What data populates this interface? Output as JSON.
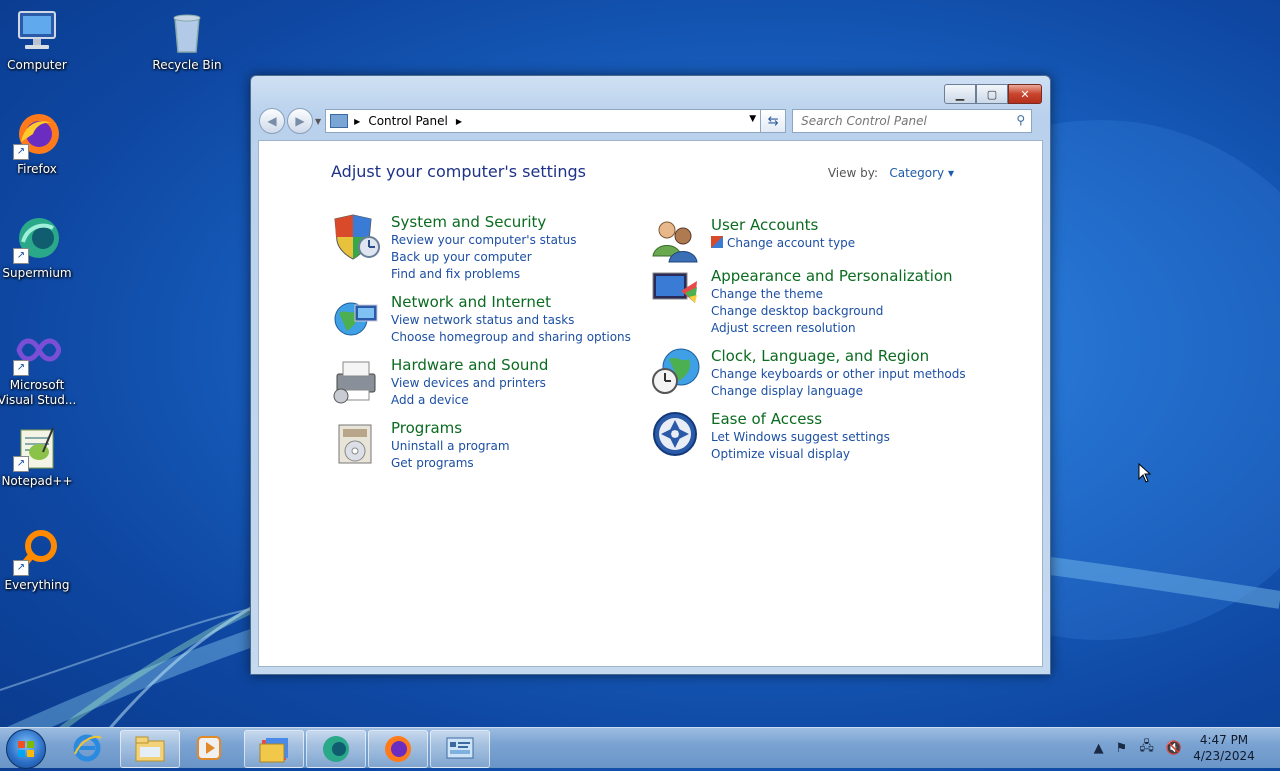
{
  "desktop": {
    "icons": [
      {
        "label": "Computer"
      },
      {
        "label": "Recycle Bin"
      },
      {
        "label": "Firefox"
      },
      {
        "label": "Supermium"
      },
      {
        "label": "Microsoft Visual Stud..."
      },
      {
        "label": "Notepad++"
      },
      {
        "label": "Everything"
      }
    ]
  },
  "window": {
    "controls": {
      "minimize": "▁",
      "maximize": "▢",
      "close": "✕"
    },
    "address": {
      "crumb": "Control Panel"
    },
    "search": {
      "placeholder": "Search Control Panel"
    },
    "content_title": "Adjust your computer's settings",
    "view_by_label": "View by:",
    "view_by_value": "Category ▾",
    "categories_left": [
      {
        "title": "System and Security",
        "icon": "shield-icon",
        "links": [
          "Review your computer's status",
          "Back up your computer",
          "Find and fix problems"
        ]
      },
      {
        "title": "Network and Internet",
        "icon": "network-globe-icon",
        "links": [
          "View network status and tasks",
          "Choose homegroup and sharing options"
        ]
      },
      {
        "title": "Hardware and Sound",
        "icon": "printer-icon",
        "links": [
          "View devices and printers",
          "Add a device"
        ]
      },
      {
        "title": "Programs",
        "icon": "programs-disc-icon",
        "links": [
          "Uninstall a program",
          "Get programs"
        ]
      }
    ],
    "categories_right": [
      {
        "title": "User Accounts",
        "icon": "users-icon",
        "links": [
          "Change account type"
        ]
      },
      {
        "title": "Appearance and Personalization",
        "icon": "monitor-palette-icon",
        "links": [
          "Change the theme",
          "Change desktop background",
          "Adjust screen resolution"
        ]
      },
      {
        "title": "Clock, Language, and Region",
        "icon": "clock-globe-icon",
        "links": [
          "Change keyboards or other input methods",
          "Change display language"
        ]
      },
      {
        "title": "Ease of Access",
        "icon": "ease-of-access-icon",
        "links": [
          "Let Windows suggest settings",
          "Optimize visual display"
        ]
      }
    ]
  },
  "taskbar": {
    "apps": [
      "internet-explorer-icon",
      "file-explorer-icon",
      "media-player-icon",
      "folder-stack-icon",
      "supermium-icon",
      "firefox-icon",
      "control-panel-icon"
    ],
    "clock_time": "4:47 PM",
    "clock_date": "4/23/2024"
  }
}
